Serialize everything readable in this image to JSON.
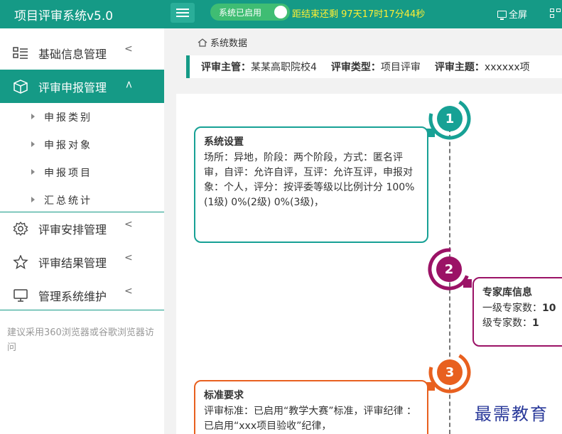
{
  "header": {
    "app_title": "项目评审系统v5.0",
    "system_status": "系统已启用",
    "countdown": "距结束还剩 97天17时17分44秒",
    "fullscreen_label": "全屏"
  },
  "sidebar": {
    "items": [
      {
        "label": "基础信息管理",
        "icon": "list-icon"
      },
      {
        "label": "评审申报管理",
        "icon": "box-icon"
      },
      {
        "label": "评审安排管理",
        "icon": "gear-icon"
      },
      {
        "label": "评审结果管理",
        "icon": "star-icon"
      },
      {
        "label": "管理系统维护",
        "icon": "monitor-icon"
      }
    ],
    "sub_items": [
      "申报类别",
      "申报对象",
      "申报项目",
      "汇总统计"
    ],
    "hint": "建议采用360浏览器或谷歌浏览器访问"
  },
  "breadcrumb": "系统数据",
  "info": {
    "director_key": "评审主管：",
    "director_val": "某某高职院校4",
    "type_key": "评审类型：",
    "type_val": "项目评审",
    "theme_key": "评审主题：",
    "theme_val": "xxxxxx项"
  },
  "timeline": [
    {
      "num": "1",
      "color": "#17a195",
      "title": "系统设置",
      "body": "场所：异地，阶段：两个阶段，方式：匿名评审，自评：允许自评，互评：允许互评，申报对象：个人，评分：按评委等级以比例计分 100%(1级) 0%(2级) 0%(3级)，"
    },
    {
      "num": "2",
      "color": "#9b1266",
      "title": "专家库信息",
      "line1_key": "一级专家数：",
      "line1_val": "10",
      "line2_key": "级专家数：",
      "line2_val": "1"
    },
    {
      "num": "3",
      "color": "#e8601f",
      "title": "标准要求",
      "body": "评审标准：已启用“教学大赛”标准，评审纪律 ：已启用“xxx项目验收”纪律，"
    }
  ],
  "watermark": "最需教育"
}
